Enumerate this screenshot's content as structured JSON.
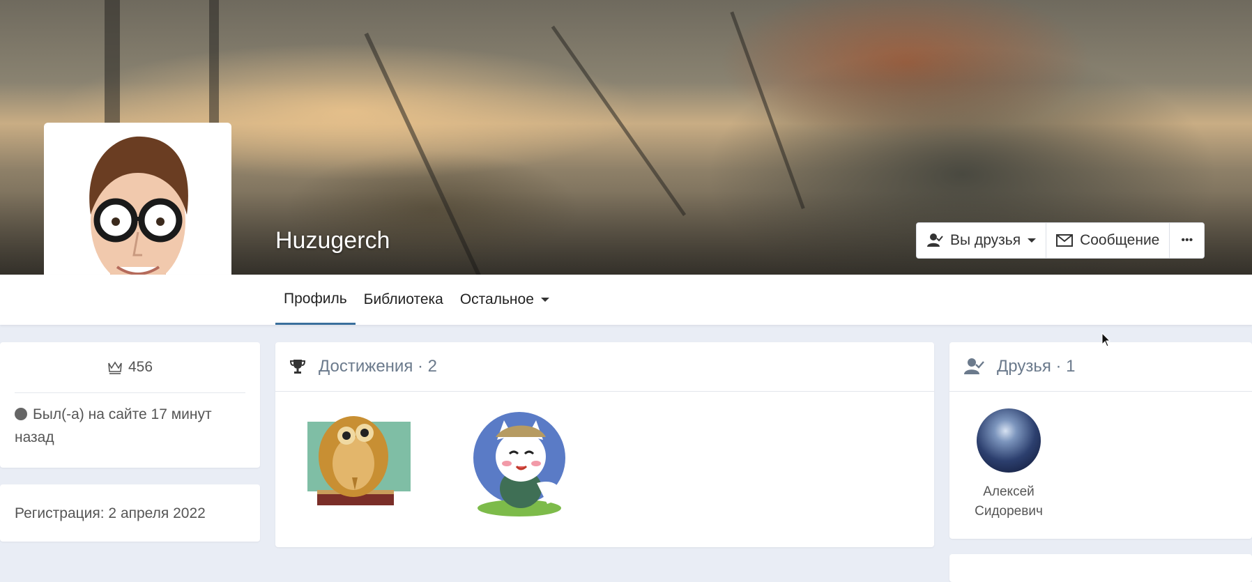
{
  "profile": {
    "name": "Huzugerch"
  },
  "actions": {
    "friends_label": "Вы друзья",
    "message_label": "Сообщение",
    "more_label": "•••"
  },
  "nav": {
    "tabs": [
      {
        "label": "Профиль",
        "active": true
      },
      {
        "label": "Библиотека",
        "active": false
      },
      {
        "label": "Остальное",
        "active": false,
        "dropdown": true
      }
    ]
  },
  "sidebar": {
    "rating_icon": "crown-icon",
    "rating_value": "456",
    "status_text": "Был(-а) на сайте 17 минут назад",
    "registration": "Регистрация: 2 апреля 2022"
  },
  "achievements": {
    "icon": "trophy-icon",
    "title": "Достижения · 2",
    "items": [
      {
        "name": "owl-on-book-badge"
      },
      {
        "name": "cat-detective-badge"
      }
    ]
  },
  "friends": {
    "icon": "friends-icon",
    "title": "Друзья · 1",
    "items": [
      {
        "first_name": "Алексей",
        "last_name": "Сидоревич"
      }
    ]
  },
  "colors": {
    "page_bg": "#e9edf5",
    "active_tab_underline": "#3a6f9c",
    "header_text": "#6b7a8c"
  }
}
